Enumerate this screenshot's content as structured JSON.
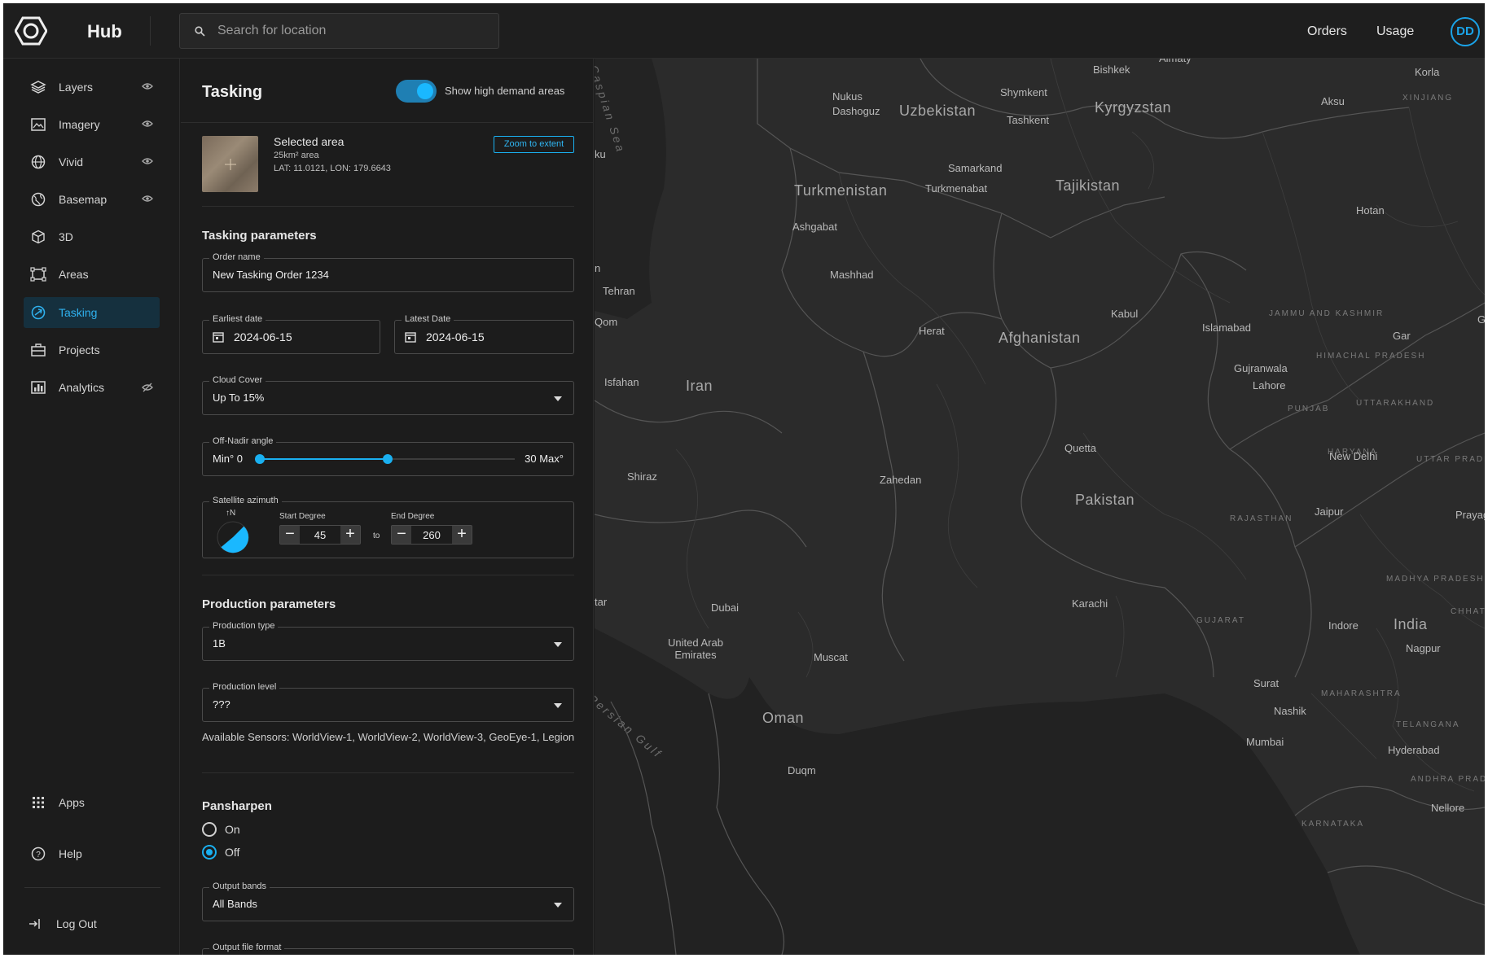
{
  "header": {
    "brand": "Hub",
    "search_placeholder": "Search for location",
    "links": [
      "Orders",
      "Usage"
    ],
    "avatar_initials": "DD"
  },
  "sidebar": {
    "items": [
      {
        "label": "Layers",
        "icon": "layers-icon",
        "eye": true
      },
      {
        "label": "Imagery",
        "icon": "imagery-icon",
        "eye": true
      },
      {
        "label": "Vivid",
        "icon": "globe-icon",
        "eye": true
      },
      {
        "label": "Basemap",
        "icon": "basemap-icon",
        "eye": true
      },
      {
        "label": "3D",
        "icon": "cube-icon",
        "eye": false
      },
      {
        "label": "Areas",
        "icon": "areas-icon",
        "eye": false
      },
      {
        "label": "Tasking",
        "icon": "tasking-icon",
        "eye": false,
        "active": true
      },
      {
        "label": "Projects",
        "icon": "briefcase-icon",
        "eye": false
      },
      {
        "label": "Analytics",
        "icon": "analytics-icon",
        "eye": true
      }
    ],
    "bottom": {
      "apps": "Apps",
      "help": "Help",
      "logout": "Log Out"
    },
    "accent": "#1ab0f0"
  },
  "panel": {
    "title": "Tasking",
    "toggle_label": "Show high demand areas",
    "toggle_on": true,
    "selected": {
      "title": "Selected area",
      "area": "25km² area",
      "coords": "LAT: 11.0121, LON: 179.6643",
      "zoom_label": "Zoom to extent"
    },
    "tasking": {
      "title": "Tasking parameters",
      "order_name_label": "Order name",
      "order_name": "New Tasking Order 1234",
      "earliest_label": "Earliest date",
      "earliest": "2024-06-15",
      "latest_label": "Latest Date",
      "latest": "2024-06-15",
      "cloud_label": "Cloud Cover",
      "cloud": "Up To 15%",
      "nadir_label": "Off-Nadir angle",
      "nadir_min": "Min° 0",
      "nadir_max": "30 Max°",
      "nadir_range_fraction": [
        0,
        0.5
      ],
      "azimuth_label": "Satellite azimuth",
      "north_label": "↑N",
      "start_label": "Start Degree",
      "start": "45",
      "to": "to",
      "end_label": "End Degree",
      "end": "260"
    },
    "production": {
      "title": "Production parameters",
      "type_label": "Production type",
      "type": "1B",
      "level_label": "Production level",
      "level": "???",
      "sensors": "Available Sensors: WorldView-1, WorldView-2, WorldView-3, GeoEye-1, Legion"
    },
    "pansharpen": {
      "title": "Pansharpen",
      "on": "On",
      "off": "Off",
      "selected": "Off",
      "bands_label": "Output bands",
      "bands": "All Bands",
      "format_label": "Output file format"
    }
  },
  "map": {
    "labels": {
      "uzbekistan": "Uzbekistan",
      "kyrgyzstan": "Kyrgyzstan",
      "tajikistan": "Tajikistan",
      "turkmenistan": "Turkmenistan",
      "afghanistan": "Afghanistan",
      "iran": "Iran",
      "pakistan": "Pakistan",
      "oman": "Oman",
      "india": "India",
      "uae": "United Arab Emirates",
      "bishkek": "Bishkek",
      "shymkent": "Shymkent",
      "tashkent": "Tashkent",
      "samarkand": "Samarkand",
      "nukus": "Nukus",
      "dashoguz": "Dashoguz",
      "turkmenabat": "Turkmenabat",
      "ashgabat": "Ashgabat",
      "mashhad": "Mashhad",
      "tehran": "Tehran",
      "qom": "Qom",
      "isfahan": "Isfahan",
      "shiraz": "Shiraz",
      "herat": "Herat",
      "kabul": "Kabul",
      "islamabad": "Islamabad",
      "gujranwala": "Gujranwala",
      "lahore": "Lahore",
      "quetta": "Quetta",
      "zahedan": "Zahedan",
      "karachi": "Karachi",
      "dubai": "Dubai",
      "muscat": "Muscat",
      "duqm": "Duqm",
      "new_delhi": "New Delhi",
      "jaipur": "Jaipur",
      "prayag": "Prayag",
      "indore": "Indore",
      "nagpur": "Nagpur",
      "surat": "Surat",
      "nashik": "Nashik",
      "mumbai": "Mumbai",
      "hyderabad": "Hyderabad",
      "nellore": "Nellore",
      "korla": "Korla",
      "aksu": "Aksu",
      "hotan": "Hotan",
      "gar": "Gar",
      "gert": "Gert",
      "almaty": "Almaty",
      "ku": "ku",
      "n": "n",
      "tar": "tar",
      "xinjiang": "XINJIANG",
      "jammu": "JAMMU AND KASHMIR",
      "himachal": "HIMACHAL PRADESH",
      "punjab": "PUNJAB",
      "haryana": "HARYANA",
      "uttarakhand": "UTTARAKHAND",
      "uttar": "UTTAR PRADESH",
      "rajasthan": "RAJASTHAN",
      "madhya": "MADHYA PRADESH",
      "gujarat": "GUJARAT",
      "chhatt": "CHHATT",
      "maharashtra": "MAHARASHTRA",
      "telangana": "TELANGANA",
      "andhra": "ANDHRA PRADESH",
      "karnataka": "KARNATAKA",
      "caspian": "Caspian Sea",
      "gulf": "Persian Gulf"
    }
  }
}
